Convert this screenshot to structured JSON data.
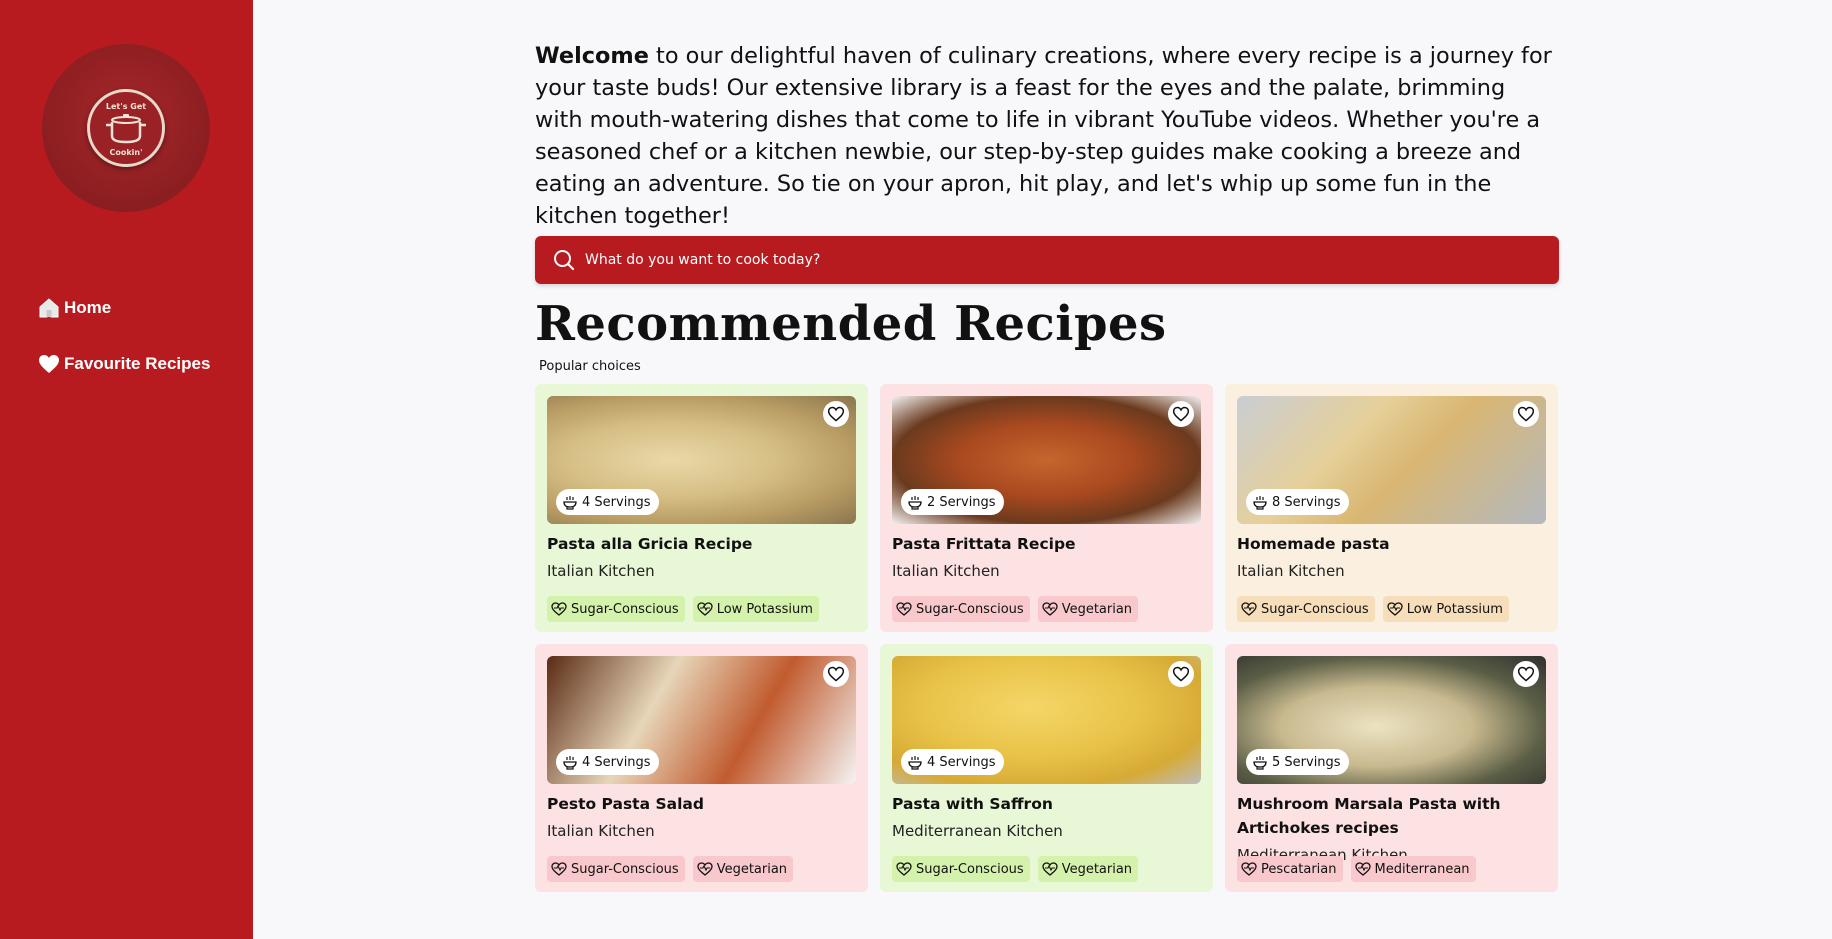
{
  "logo": {
    "top_text": "Let's Get",
    "bottom_text": "Cookin'"
  },
  "nav": [
    {
      "label": "Home",
      "icon": "home-icon"
    },
    {
      "label": "Favourite Recipes",
      "icon": "heart-icon"
    }
  ],
  "intro": {
    "bold": "Welcome",
    "text": " to our delightful haven of culinary creations, where every recipe is a journey for your taste buds! Our extensive library is a feast for the eyes and the palate, brimming with mouth-watering dishes that come to life in vibrant YouTube videos. Whether you're a seasoned chef or a kitchen newbie, our step-by-step guides make cooking a breeze and eating an adventure. So tie on your apron, hit play, and let's whip up some fun in the kitchen together!"
  },
  "search": {
    "placeholder": "What do you want to cook today?"
  },
  "section": {
    "title": "Recommended Recipes",
    "subtitle": "Popular choices"
  },
  "colors": {
    "sidebar": "#b71b1f",
    "green": "#e8f7d6",
    "pink": "#fde2e4",
    "cream": "#fbf0df"
  },
  "recipes": [
    {
      "name": "Pasta alla Gricia Recipe",
      "kitchen": "Italian Kitchen",
      "servings": "4 Servings",
      "theme": "green",
      "tags": [
        "Sugar-Conscious",
        "Low Potassium"
      ]
    },
    {
      "name": "Pasta Frittata Recipe",
      "kitchen": "Italian Kitchen",
      "servings": "2 Servings",
      "theme": "pink",
      "tags": [
        "Sugar-Conscious",
        "Vegetarian"
      ]
    },
    {
      "name": "Homemade pasta",
      "kitchen": "Italian Kitchen",
      "servings": "8 Servings",
      "theme": "cream",
      "tags": [
        "Sugar-Conscious",
        "Low Potassium"
      ]
    },
    {
      "name": "Pesto Pasta Salad",
      "kitchen": "Italian Kitchen",
      "servings": "4 Servings",
      "theme": "pink",
      "tags": [
        "Sugar-Conscious",
        "Vegetarian"
      ]
    },
    {
      "name": "Pasta with Saffron",
      "kitchen": "Mediterranean Kitchen",
      "servings": "4 Servings",
      "theme": "green",
      "tags": [
        "Sugar-Conscious",
        "Vegetarian"
      ]
    },
    {
      "name": "Mushroom Marsala Pasta with Artichokes recipes",
      "kitchen": "Mediterranean Kitchen",
      "servings": "5 Servings",
      "theme": "pink",
      "tags": [
        "Pescatarian",
        "Mediterranean"
      ]
    }
  ]
}
